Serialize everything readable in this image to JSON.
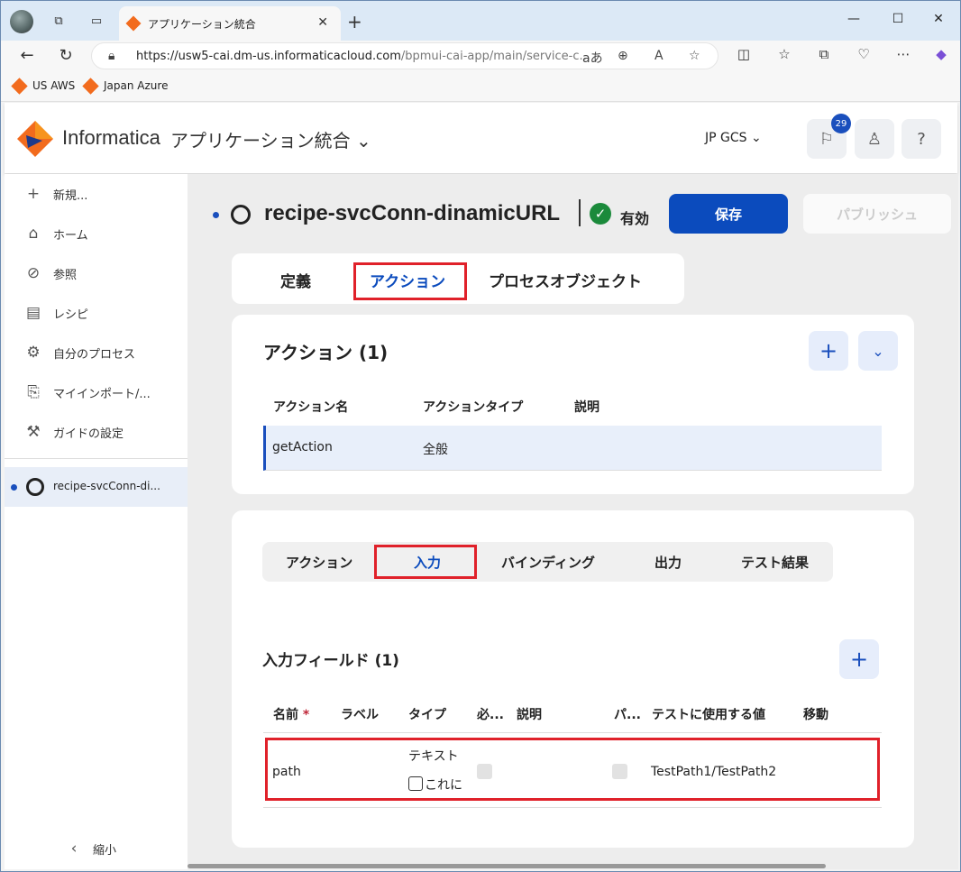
{
  "browser": {
    "tab_title": "アプリケーション統合",
    "url_host": "https://usw5-cai.dm-us.informaticacloud.com",
    "url_rest": "/bpmui-cai-app/main/service-c...",
    "bookmarks": [
      "US AWS",
      "Japan Azure"
    ]
  },
  "header": {
    "brand": "Informatica",
    "app_name": "アプリケーション統合",
    "org": "JP GCS",
    "notification_count": "29"
  },
  "sidebar": {
    "items": [
      {
        "label": "新規...",
        "icon": "plus-icon"
      },
      {
        "label": "ホーム",
        "icon": "home-icon"
      },
      {
        "label": "参照",
        "icon": "compass-icon"
      },
      {
        "label": "レシピ",
        "icon": "recipe-icon"
      },
      {
        "label": "自分のプロセス",
        "icon": "process-icon"
      },
      {
        "label": "マイインポート/...",
        "icon": "import-icon"
      },
      {
        "label": "ガイドの設定",
        "icon": "wrench-icon"
      }
    ],
    "open_item": "recipe-svcConn-di...",
    "collapse_label": "縮小"
  },
  "page": {
    "title": "recipe-svcConn-dinamicURL",
    "status": "有効",
    "save_label": "保存",
    "publish_label": "パブリッシュ",
    "tabs": [
      "定義",
      "アクション",
      "プロセスオブジェクト"
    ],
    "active_tab": "アクション"
  },
  "actions_card": {
    "title": "アクション (1)",
    "columns": [
      "アクション名",
      "アクションタイプ",
      "説明"
    ],
    "rows": [
      {
        "name": "getAction",
        "type": "全般",
        "desc": ""
      }
    ]
  },
  "detail_card": {
    "tabs": [
      "アクション",
      "入力",
      "バインディング",
      "出力",
      "テスト結果"
    ],
    "active_tab": "入力",
    "section_title": "入力フィールド (1)",
    "columns": [
      "名前",
      "ラベル",
      "タイプ",
      "必...",
      "説明",
      "パ...",
      "テストに使用する値",
      "移動"
    ],
    "required_mark": "*",
    "rows": [
      {
        "name": "path",
        "label": "",
        "type": "テキスト",
        "type_option": "これに",
        "test_value": "TestPath1/TestPath2"
      }
    ]
  },
  "colors": {
    "accent": "#0b4bbd",
    "highlight": "#e0212a",
    "success": "#1b8a3b"
  }
}
